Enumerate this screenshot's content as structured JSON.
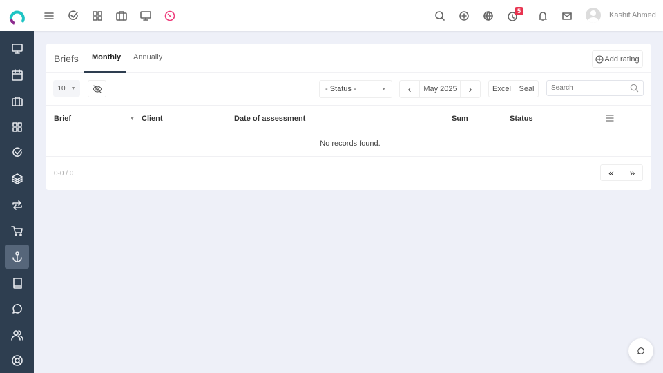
{
  "header": {
    "badge_count": "5",
    "user_name": "Kashif Ahmed"
  },
  "card": {
    "title": "Briefs",
    "tabs": [
      {
        "label": "Monthly"
      },
      {
        "label": "Annually"
      }
    ],
    "add_rating_label": "Add rating",
    "page_size": "10",
    "status_placeholder": "- Status -",
    "period": "May 2025",
    "excel_label": "Excel",
    "seal_label": "Seal",
    "search_placeholder": "Search",
    "columns": [
      "Brief",
      "Client",
      "Date of assessment",
      "Sum",
      "Status"
    ],
    "empty_message": "No records found.",
    "range": "0-0 / 0",
    "first_label": "«",
    "last_label": "»"
  }
}
